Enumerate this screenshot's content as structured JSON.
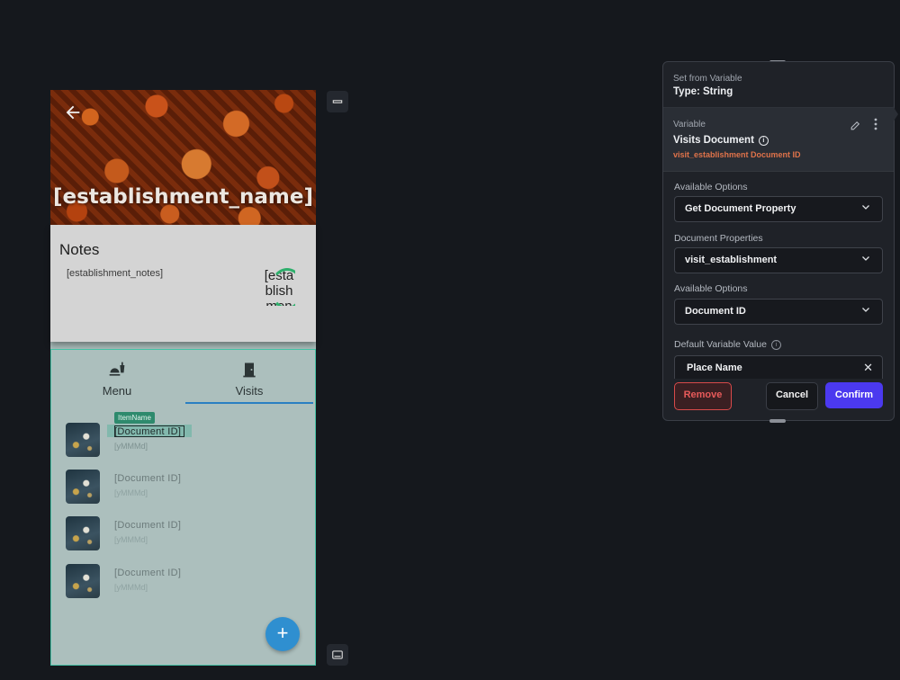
{
  "app": {
    "hero_title": "[establishment_name]",
    "notes_title": "Notes",
    "notes_body": "[establishment_notes]",
    "notes_ring_text": "[establishment]",
    "tabs": [
      {
        "label": "Menu",
        "icon": "restaurant-icon"
      },
      {
        "label": "Visits",
        "icon": "door-icon"
      }
    ],
    "list_items": [
      {
        "badge": "ItemName",
        "title": "[Document ID]",
        "sub": "[yMMMd]"
      },
      {
        "title": "[Document ID]",
        "sub": "[yMMMd]"
      },
      {
        "title": "[Document ID]",
        "sub": "[yMMMd]"
      },
      {
        "title": "[Document ID]",
        "sub": "[yMMMd]"
      }
    ],
    "fab_label": "+"
  },
  "dialog": {
    "kicker": "Set from Variable",
    "type_label": "Type: String",
    "variable_kicker": "Variable",
    "variable_name": "Visits Document",
    "variable_path": "visit_establishment Document ID",
    "fields": [
      {
        "label": "Available Options",
        "value": "Get Document Property"
      },
      {
        "label": "Document Properties",
        "value": "visit_establishment"
      },
      {
        "label": "Available Options",
        "value": "Document ID"
      }
    ],
    "default_label": "Default Variable Value",
    "default_value": "Place Name",
    "buttons": {
      "remove": "Remove",
      "cancel": "Cancel",
      "confirm": "Confirm"
    }
  },
  "colors": {
    "confirm": "#4b39ef",
    "remove": "#d84a4a",
    "path": "#e0734a",
    "tab_underline": "#2a7fc2",
    "fab": "#2f8fd0",
    "panel_border": "#45c2a6"
  }
}
